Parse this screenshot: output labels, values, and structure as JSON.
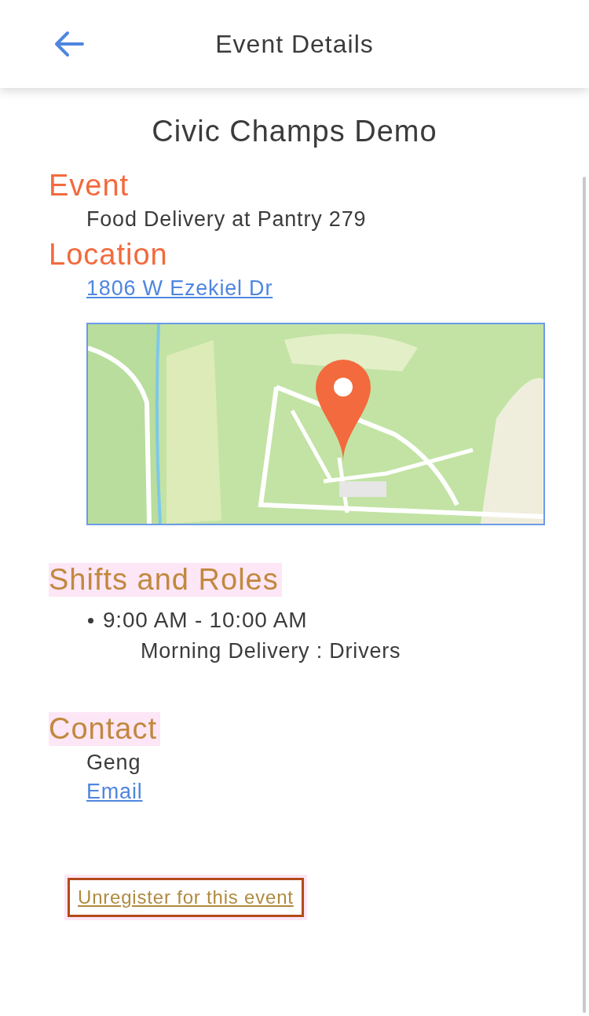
{
  "header": {
    "title": "Event Details"
  },
  "event_title": "Civic Champs Demo",
  "sections": [
    {
      "kind": "text",
      "heading": "Event",
      "highlighted": false,
      "lines": [
        "Food Delivery at Pantry 279"
      ]
    },
    {
      "kind": "location",
      "heading": "Location",
      "highlighted": false,
      "link": "1806 W Ezekiel Dr"
    },
    {
      "kind": "shifts",
      "heading": "Shifts and Roles",
      "highlighted": true,
      "shifts": [
        {
          "time": "9:00 AM - 10:00 AM",
          "role": "Morning Delivery : Drivers"
        }
      ]
    },
    {
      "kind": "contact",
      "heading": "Contact",
      "highlighted": true,
      "name": "Geng",
      "link": "Email"
    }
  ],
  "action": {
    "label": "Unregister for this event"
  }
}
